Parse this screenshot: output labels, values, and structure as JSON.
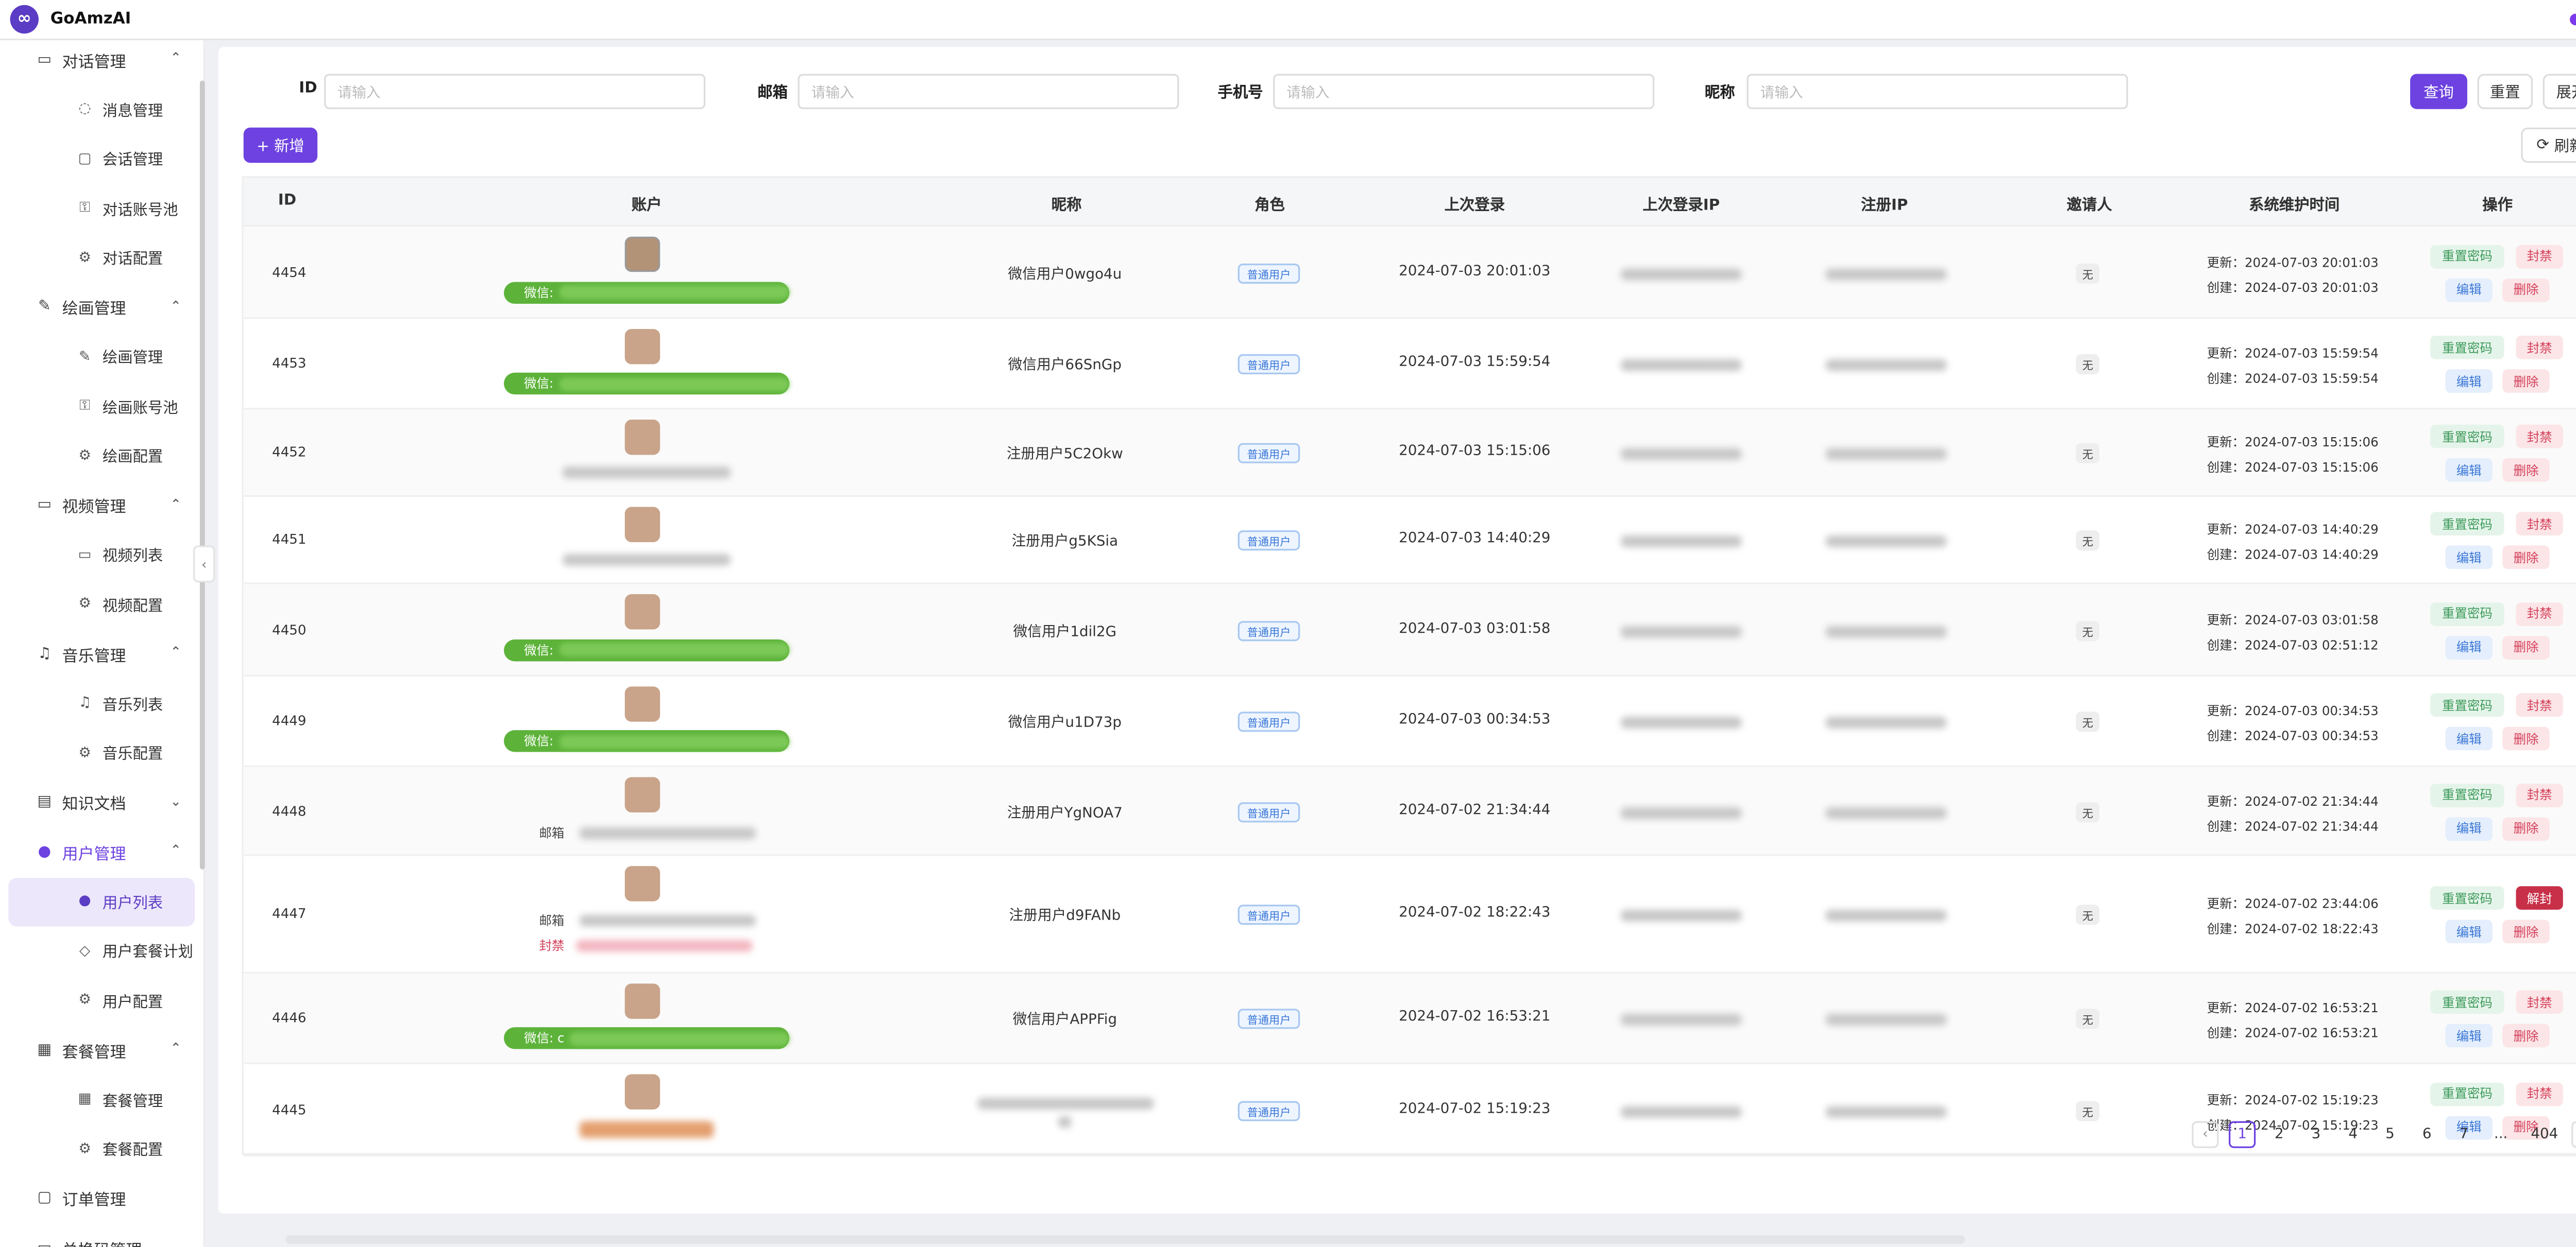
{
  "app": {
    "brand": "GoAmzAI"
  },
  "sidebar": {
    "groups": [
      {
        "label": "对话管理",
        "icon": "chat-manage-icon",
        "items": [
          {
            "label": "消息管理",
            "icon": "message-icon"
          },
          {
            "label": "会话管理",
            "icon": "session-icon"
          },
          {
            "label": "对话账号池",
            "icon": "key-icon"
          },
          {
            "label": "对话配置",
            "icon": "gear-icon"
          }
        ]
      },
      {
        "label": "绘画管理",
        "icon": "brush-icon",
        "items": [
          {
            "label": "绘画管理",
            "icon": "brush-icon"
          },
          {
            "label": "绘画账号池",
            "icon": "key-icon"
          },
          {
            "label": "绘画配置",
            "icon": "gear-icon"
          }
        ]
      },
      {
        "label": "视频管理",
        "icon": "video-icon",
        "items": [
          {
            "label": "视频列表",
            "icon": "video-icon"
          },
          {
            "label": "视频配置",
            "icon": "gear-icon"
          }
        ]
      },
      {
        "label": "音乐管理",
        "icon": "music-icon",
        "items": [
          {
            "label": "音乐列表",
            "icon": "music-icon"
          },
          {
            "label": "音乐配置",
            "icon": "gear-icon"
          }
        ]
      },
      {
        "label": "知识文档",
        "icon": "book-icon",
        "items": []
      },
      {
        "label": "用户管理",
        "icon": "user-icon",
        "items": [
          {
            "label": "用户列表",
            "icon": "user-icon"
          },
          {
            "label": "用户套餐计划",
            "icon": "diamond-icon"
          },
          {
            "label": "用户配置",
            "icon": "gear-icon"
          }
        ]
      },
      {
        "label": "套餐管理",
        "icon": "package-icon",
        "items": [
          {
            "label": "套餐管理",
            "icon": "package-icon"
          },
          {
            "label": "套餐配置",
            "icon": "gear-icon"
          }
        ]
      },
      {
        "label": "订单管理",
        "icon": "bag-icon",
        "items": []
      },
      {
        "label": "兑换码管理",
        "icon": "ticket-icon",
        "items": []
      }
    ]
  },
  "search": {
    "id_label": "ID",
    "email_label": "邮箱",
    "phone_label": "手机号",
    "nickname_label": "昵称",
    "placeholder": "请输入",
    "query": "查询",
    "reset": "重置",
    "expand": "展开"
  },
  "toolbar": {
    "add": "+ 新增",
    "refresh": "刷新"
  },
  "table": {
    "headers": [
      "ID",
      "账户",
      "昵称",
      "角色",
      "上次登录",
      "上次登录IP",
      "注册IP",
      "邀请人",
      "系统维护时间",
      "操作"
    ],
    "rows": [
      {
        "id": "4454",
        "nickname": "微信用户0wgo4u",
        "role": "普通用户",
        "last_login": "2024-07-03 20:01:03",
        "inviter": "无",
        "updated": "更新：2024-07-03 20:01:03",
        "created": "创建：2024-07-03 20:01:03",
        "account_type": "wechat",
        "account_label": "微信:",
        "banned": false
      },
      {
        "id": "4453",
        "nickname": "微信用户66SnGp",
        "role": "普通用户",
        "last_login": "2024-07-03 15:59:54",
        "inviter": "无",
        "updated": "更新：2024-07-03 15:59:54",
        "created": "创建：2024-07-03 15:59:54",
        "account_type": "wechat",
        "account_label": "微信:",
        "banned": false
      },
      {
        "id": "4452",
        "nickname": "注册用户5C2Okw",
        "role": "普通用户",
        "last_login": "2024-07-03 15:15:06",
        "inviter": "无",
        "updated": "更新：2024-07-03 15:15:06",
        "created": "创建：2024-07-03 15:15:06",
        "account_type": "blurred",
        "account_label": "",
        "banned": false
      },
      {
        "id": "4451",
        "nickname": "注册用户g5KSia",
        "role": "普通用户",
        "last_login": "2024-07-03 14:40:29",
        "inviter": "无",
        "updated": "更新：2024-07-03 14:40:29",
        "created": "创建：2024-07-03 14:40:29",
        "account_type": "blurred",
        "account_label": "",
        "banned": false
      },
      {
        "id": "4450",
        "nickname": "微信用户1dil2G",
        "role": "普通用户",
        "last_login": "2024-07-03 03:01:58",
        "inviter": "无",
        "updated": "更新：2024-07-03 03:01:58",
        "created": "创建：2024-07-03 02:51:12",
        "account_type": "wechat",
        "account_label": "微信:",
        "banned": false
      },
      {
        "id": "4449",
        "nickname": "微信用户u1D73p",
        "role": "普通用户",
        "last_login": "2024-07-03 00:34:53",
        "inviter": "无",
        "updated": "更新：2024-07-03 00:34:53",
        "created": "创建：2024-07-03 00:34:53",
        "account_type": "wechat",
        "account_label": "微信:",
        "banned": false
      },
      {
        "id": "4448",
        "nickname": "注册用户YgNOA7",
        "role": "普通用户",
        "last_login": "2024-07-02 21:34:44",
        "inviter": "无",
        "updated": "更新：2024-07-02 21:34:44",
        "created": "创建：2024-07-02 21:34:44",
        "account_type": "email",
        "account_label": "邮箱",
        "banned": false
      },
      {
        "id": "4447",
        "nickname": "注册用户d9FANb",
        "role": "普通用户",
        "last_login": "2024-07-02 18:22:43",
        "inviter": "无",
        "updated": "更新：2024-07-02 23:44:06",
        "created": "创建：2024-07-02 18:22:43",
        "account_type": "email",
        "account_label": "邮箱",
        "banned": true,
        "ban_label": "封禁"
      },
      {
        "id": "4446",
        "nickname": "微信用户APPFig",
        "role": "普通用户",
        "last_login": "2024-07-02 16:53:21",
        "inviter": "无",
        "updated": "更新：2024-07-02 16:53:21",
        "created": "创建：2024-07-02 16:53:21",
        "account_type": "wechat",
        "account_label": "微信: c",
        "banned": false
      },
      {
        "id": "4445",
        "nickname": "",
        "role": "普通用户",
        "last_login": "2024-07-02 15:19:23",
        "inviter": "无",
        "updated": "更新：2024-07-02 15:19:23",
        "created": "创建：2024-07-02 15:19:23",
        "account_type": "orange",
        "account_label": "",
        "banned": false
      }
    ],
    "actions": {
      "reset_pwd": "重置密码",
      "ban": "封禁",
      "unban": "解封",
      "edit": "编辑",
      "delete": "删除"
    }
  },
  "pagination": {
    "pages": [
      "1",
      "2",
      "3",
      "4",
      "5",
      "6",
      "7",
      "...",
      "404"
    ],
    "current": "1"
  },
  "colors": {
    "primary": "#6d42e0",
    "wechat": "#5db33a",
    "danger": "#d4405a",
    "success": "#3c9a5a",
    "info": "#3b78d8"
  }
}
